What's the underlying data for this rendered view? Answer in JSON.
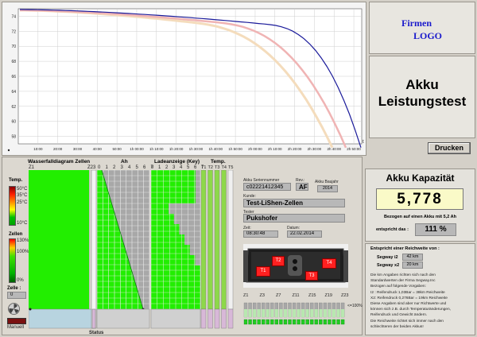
{
  "curve_chart": {
    "y_ticks": [
      "74",
      "72",
      "70",
      "68",
      "66",
      "64",
      "62",
      "60",
      "58"
    ],
    "x_ticks": [
      "10:00",
      "20:00",
      "30:00",
      "40:00",
      "50:00",
      "1h 00:00",
      "1h 10:00",
      "1h 20:00",
      "1h 30:00",
      "1h 40:00",
      "1h 50:00",
      "2h 00:00",
      "2h 10:00",
      "2h 20:00",
      "2h 30:00",
      "2h 40:00",
      "2h 50:00"
    ],
    "end_label": "t",
    "y_range": [
      57,
      75
    ]
  },
  "logo": {
    "line1": "Firmen",
    "line2": "LOGO"
  },
  "title": {
    "line1": "Akku",
    "line2": "Leistungstest"
  },
  "print_button": "Drucken",
  "waterfall": {
    "title": "Wasserfalldiagram Zellen",
    "z1": "Z1",
    "z23": "Z23",
    "ah_title": "Ah",
    "ah_ticks": [
      "0",
      "1",
      "2",
      "3",
      "4",
      "5",
      "6",
      "7"
    ],
    "load_title": "Ladeanzeige (Key)",
    "load_ticks": [
      "0",
      "1",
      "2",
      "3",
      "4",
      "5",
      "6",
      "7"
    ],
    "temp_title": "Temp.",
    "temp_ticks": [
      "T1",
      "T2",
      "T3",
      "T4",
      "T5"
    ],
    "status_label": "Status"
  },
  "temp_legend": {
    "title": "Temp.",
    "values": [
      "50°C",
      "35°C",
      "25°C",
      "10°C"
    ]
  },
  "cell_legend": {
    "title": "Zellen",
    "values": [
      "130%",
      "100%",
      "0%"
    ]
  },
  "cell_counter": {
    "label": "Zelle :",
    "value": "0"
  },
  "manual_label": "Manuell",
  "info": {
    "serial_label": "Akku Seriennummer",
    "serial_value": "c02221412345",
    "rev_label": "Rev.:",
    "rev_value": "AF",
    "year_label": "Akku Baujahr",
    "year_value": "2014",
    "customer_label": "Kunde:",
    "customer_value": "Test-LiShen-Zellen",
    "tester_label": "Tester",
    "tester_value": "Pukshofer",
    "time_label": "Zeit:",
    "time_value": "08:30:48",
    "date_label": "Datum:",
    "date_value": "22.02.2014"
  },
  "battery_labels": {
    "t1": "T1",
    "t2": "T2",
    "t3": "T3",
    "t4": "T4"
  },
  "cell_bar": {
    "ticks": [
      "Z1",
      "Z3",
      "Z7",
      "Z11",
      "Z15",
      "Z19",
      "Z23"
    ],
    "end_label": "<=100%"
  },
  "capacity": {
    "title": "Akku Kapazität",
    "value": "5,778",
    "based_on": "Bezogen auf einen Akku mit 5,2 Ah",
    "corresponds_label": "entspricht das :",
    "percent": "111  %"
  },
  "range": {
    "title": "Entspricht einer Reichweite von :",
    "rows": [
      {
        "label": "Segway i2",
        "value": "42  km"
      },
      {
        "label": "Segway x2",
        "value": "20  km"
      }
    ],
    "note": [
      "Die km Angaben richten sich nach den",
      "Standardwerten der Firma Segway.Inc",
      "Bezogen auf folgende Vorgaben:",
      "I2 : Reifendruck 1,03Bar = 38km Reichweite",
      "X2: Reifendruck 0,276Bar = 19km Reichweite",
      "Diese Angaben sind aber nur Richtwerte und",
      "können sich z.B. durch Temperaturänderungen,",
      "Reifendruck und Gewicht ändern.",
      "Die Reichweite richtet sich immer nach den",
      "schlechteren der beiden Akkus!"
    ]
  },
  "colors": {
    "green": "#22ee00",
    "grid_gray": "#a8a8a8",
    "curve_blue": "#1a1a9a",
    "curve_pink": "#f0b4b4",
    "curve_tan": "#f4dcbc",
    "logo_blue": "#1a1acc"
  }
}
